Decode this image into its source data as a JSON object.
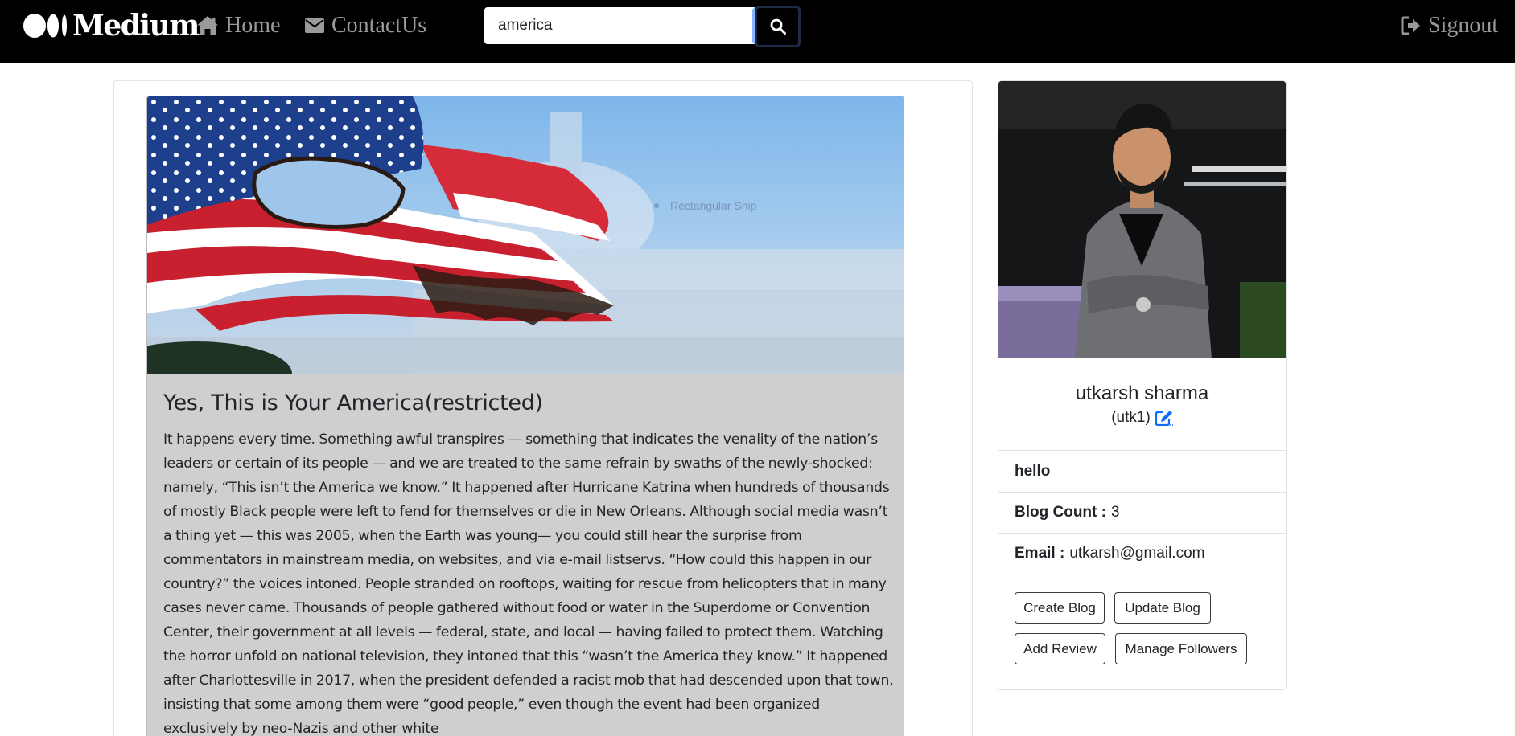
{
  "navbar": {
    "brand": "Medium",
    "home_label": "Home",
    "contact_label": "ContactUs",
    "signout_label": "Signout",
    "search_value": "america"
  },
  "blog": {
    "image_overlay_label": "Rectangular Snip",
    "title": "Yes, This is Your America(restricted)",
    "body": "It happens every time. Something awful transpires — something that indicates the venality of the nation’s leaders or certain of its people — and we are treated to the same refrain by swaths of the newly-shocked: namely, “This isn’t the America we know.” It happened after Hurricane Katrina when hundreds of thousands of mostly Black people were left to fend for themselves or die in New Orleans. Although social media wasn’t a thing yet — this was 2005, when the Earth was young— you could still hear the surprise from commentators in mainstream media, on websites, and via e-mail listservs. “How could this happen in our country?” the voices intoned. People stranded on rooftops, waiting for rescue from helicopters that in many cases never came. Thousands of people gathered without food or water in the Superdome or Convention Center, their government at all levels — federal, state, and local — having failed to protect them. Watching the horror unfold on national television, they intoned that this “wasn’t the America they know.” It happened after Charlottesville in 2017, when the president defended a racist mob that had descended upon that town, insisting that some among them were “good people,” even though the event had been organized exclusively by neo-Nazis and other white"
  },
  "profile": {
    "name": "utkarsh sharma",
    "handle": "(utk1)",
    "bio": "hello",
    "blog_count_label": "Blog Count :",
    "blog_count": "3",
    "email_label": "Email :",
    "email": "utkarsh@gmail.com",
    "buttons": {
      "create": "Create Blog",
      "update": "Update Blog",
      "review": "Add Review",
      "followers": "Manage Followers"
    }
  },
  "colors": {
    "navbar_bg": "#000000",
    "nav_link": "#9a9a9a",
    "edit_icon": "#0d6efd",
    "blog_card_bg": "#cfcfcf"
  },
  "icons": [
    "medium-logo-icon",
    "home-icon",
    "envelope-icon",
    "search-icon",
    "signout-icon",
    "edit-icon"
  ]
}
